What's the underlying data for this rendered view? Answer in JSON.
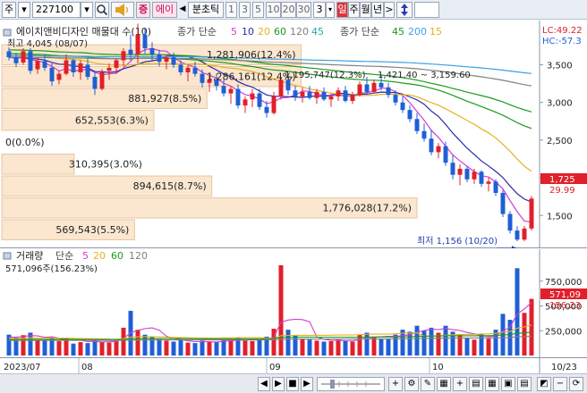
{
  "toolbar": {
    "type_label": "주",
    "code": "227100",
    "search_icon": "magnifier-icon",
    "sound_icon": "speaker-icon",
    "badge": "증",
    "stock_name": "에이",
    "nav_left": "◀",
    "interval_label": "분초틱",
    "intervals": [
      "1",
      "3",
      "5",
      "10",
      "20",
      "30"
    ],
    "period_value": "3",
    "day_label": "일",
    "week_label": "주",
    "month_label": "월",
    "year_label": "년",
    "nav_right": ">",
    "updown_icon": "up-down-arrows-icon"
  },
  "price_legend": {
    "title": "에이치앤비디자인 매물대 수(10)",
    "ma_label": "종가 단순",
    "ma_periods": [
      "5",
      "10",
      "20",
      "60",
      "120",
      "45"
    ],
    "ma_colors": [
      "#d23cd2",
      "#2a2aa6",
      "#e6b21c",
      "#1c9a1c",
      "#808080",
      "#26a6a6"
    ],
    "ma2_label": "종가 단순",
    "ma2_periods": [
      "45",
      "200",
      "15"
    ],
    "ma2_colors": [
      "#1c9a1c",
      "#3ca0e6",
      "#e6b21c"
    ]
  },
  "price_axis": {
    "ticks": [
      "3,500",
      "3,000",
      "2,500",
      "2,000",
      "1,500"
    ],
    "lc": "LC:49.22",
    "hc": "HC:-57.3",
    "current_price": "1,725",
    "current_pct": "29.99"
  },
  "annotations": {
    "high": "최고 4,045 (08/07)",
    "low": "최저 1,156 (10/20)",
    "line1": "1,195,747(12.3%)",
    "line2": "1,421.40 ~ 3,159.60"
  },
  "volume_profile": [
    {
      "label": "1,281,906(12.4%)"
    },
    {
      "label": "1,286,161(12.4%)"
    },
    {
      "label": "881,927(8.5%)"
    },
    {
      "label": "652,553(6.3%)"
    },
    {
      "label": "0(0.0%)"
    },
    {
      "label": "310,395(3.0%)"
    },
    {
      "label": "894,615(8.7%)"
    },
    {
      "label": "1,776,028(17.2%)"
    },
    {
      "label": "569,543(5.5%)"
    }
  ],
  "volume_legend": {
    "title": "거래량",
    "ma_label": "단순",
    "periods": [
      "5",
      "20",
      "60",
      "120"
    ],
    "colors": [
      "#d23cd2",
      "#e6b21c",
      "#1c9a1c",
      "#808080"
    ],
    "current_value": "571,096주(156.23%)"
  },
  "volume_axis": {
    "ticks": [
      "750,000",
      "500,000",
      "250,000"
    ],
    "current_volume": "571,09",
    "current_ratio": "156.23"
  },
  "date_axis": {
    "labels": [
      "2023/07",
      "08",
      "09",
      "10",
      "10/23"
    ]
  },
  "chart_data": {
    "type": "candlestick",
    "title": "에이치앤비디자인",
    "ylim": [
      1100,
      3850
    ],
    "volume_ylim": [
      0,
      1000000
    ],
    "up_color": "#e0202a",
    "down_color": "#1f5fd6",
    "candles": [
      {
        "o": 3680,
        "h": 3730,
        "l": 3560,
        "c": 3600,
        "v": 210000
      },
      {
        "o": 3600,
        "h": 3660,
        "l": 3470,
        "c": 3520,
        "v": 180000
      },
      {
        "o": 3530,
        "h": 3720,
        "l": 3500,
        "c": 3680,
        "v": 205000
      },
      {
        "o": 3680,
        "h": 3720,
        "l": 3380,
        "c": 3420,
        "v": 230000
      },
      {
        "o": 3440,
        "h": 3600,
        "l": 3380,
        "c": 3550,
        "v": 160000
      },
      {
        "o": 3550,
        "h": 3640,
        "l": 3420,
        "c": 3460,
        "v": 150000
      },
      {
        "o": 3460,
        "h": 3520,
        "l": 3220,
        "c": 3280,
        "v": 190000
      },
      {
        "o": 3300,
        "h": 3420,
        "l": 3240,
        "c": 3380,
        "v": 145000
      },
      {
        "o": 3380,
        "h": 3640,
        "l": 3360,
        "c": 3560,
        "v": 175000
      },
      {
        "o": 3560,
        "h": 3580,
        "l": 3340,
        "c": 3400,
        "v": 120000
      },
      {
        "o": 3400,
        "h": 3560,
        "l": 3300,
        "c": 3520,
        "v": 135000
      },
      {
        "o": 3500,
        "h": 3580,
        "l": 3300,
        "c": 3340,
        "v": 125000
      },
      {
        "o": 3340,
        "h": 3420,
        "l": 3100,
        "c": 3180,
        "v": 160000
      },
      {
        "o": 3180,
        "h": 3440,
        "l": 3160,
        "c": 3400,
        "v": 140000
      },
      {
        "o": 3420,
        "h": 3520,
        "l": 3300,
        "c": 3460,
        "v": 130000
      },
      {
        "o": 3460,
        "h": 3580,
        "l": 3380,
        "c": 3560,
        "v": 150000
      },
      {
        "o": 3560,
        "h": 3720,
        "l": 3480,
        "c": 3680,
        "v": 280000
      },
      {
        "o": 3700,
        "h": 3900,
        "l": 3560,
        "c": 3640,
        "v": 450000
      },
      {
        "o": 3640,
        "h": 4045,
        "l": 3520,
        "c": 3900,
        "v": 260000
      },
      {
        "o": 3900,
        "h": 3980,
        "l": 3650,
        "c": 3720,
        "v": 210000
      },
      {
        "o": 3720,
        "h": 3800,
        "l": 3560,
        "c": 3640,
        "v": 190000
      },
      {
        "o": 3640,
        "h": 3700,
        "l": 3480,
        "c": 3540,
        "v": 165000
      },
      {
        "o": 3540,
        "h": 3640,
        "l": 3440,
        "c": 3600,
        "v": 150000
      },
      {
        "o": 3600,
        "h": 3660,
        "l": 3460,
        "c": 3500,
        "v": 140000
      },
      {
        "o": 3500,
        "h": 3560,
        "l": 3360,
        "c": 3400,
        "v": 155000
      },
      {
        "o": 3400,
        "h": 3500,
        "l": 3280,
        "c": 3460,
        "v": 130000
      },
      {
        "o": 3460,
        "h": 3540,
        "l": 3340,
        "c": 3380,
        "v": 125000
      },
      {
        "o": 3380,
        "h": 3440,
        "l": 3200,
        "c": 3260,
        "v": 150000
      },
      {
        "o": 3260,
        "h": 3360,
        "l": 3140,
        "c": 3300,
        "v": 135000
      },
      {
        "o": 3300,
        "h": 3380,
        "l": 3160,
        "c": 3220,
        "v": 140000
      },
      {
        "o": 3220,
        "h": 3300,
        "l": 3080,
        "c": 3120,
        "v": 160000
      },
      {
        "o": 3120,
        "h": 3220,
        "l": 2980,
        "c": 3180,
        "v": 155000
      },
      {
        "o": 3180,
        "h": 3240,
        "l": 2920,
        "c": 2960,
        "v": 175000
      },
      {
        "o": 2960,
        "h": 3080,
        "l": 2860,
        "c": 3040,
        "v": 150000
      },
      {
        "o": 3040,
        "h": 3180,
        "l": 2940,
        "c": 3120,
        "v": 145000
      },
      {
        "o": 3120,
        "h": 3180,
        "l": 2900,
        "c": 2940,
        "v": 160000
      },
      {
        "o": 2940,
        "h": 3020,
        "l": 2800,
        "c": 2860,
        "v": 190000
      },
      {
        "o": 2860,
        "h": 3140,
        "l": 2840,
        "c": 3080,
        "v": 270000
      },
      {
        "o": 3080,
        "h": 3340,
        "l": 3040,
        "c": 3300,
        "v": 910000
      },
      {
        "o": 3300,
        "h": 3380,
        "l": 3100,
        "c": 3160,
        "v": 260000
      },
      {
        "o": 3160,
        "h": 3220,
        "l": 3020,
        "c": 3080,
        "v": 200000
      },
      {
        "o": 3080,
        "h": 3200,
        "l": 3000,
        "c": 3140,
        "v": 170000
      },
      {
        "o": 3140,
        "h": 3220,
        "l": 3040,
        "c": 3060,
        "v": 160000
      },
      {
        "o": 3060,
        "h": 3180,
        "l": 2980,
        "c": 3140,
        "v": 150000
      },
      {
        "o": 3140,
        "h": 3200,
        "l": 3020,
        "c": 3040,
        "v": 140000
      },
      {
        "o": 3040,
        "h": 3120,
        "l": 2940,
        "c": 3080,
        "v": 145000
      },
      {
        "o": 3080,
        "h": 3200,
        "l": 3020,
        "c": 3160,
        "v": 160000
      },
      {
        "o": 3160,
        "h": 3220,
        "l": 3000,
        "c": 3020,
        "v": 150000
      },
      {
        "o": 3020,
        "h": 3140,
        "l": 2980,
        "c": 3100,
        "v": 140000
      },
      {
        "o": 3100,
        "h": 3280,
        "l": 3080,
        "c": 3240,
        "v": 210000
      },
      {
        "o": 3240,
        "h": 3340,
        "l": 3100,
        "c": 3140,
        "v": 230000
      },
      {
        "o": 3140,
        "h": 3300,
        "l": 3120,
        "c": 3260,
        "v": 190000
      },
      {
        "o": 3260,
        "h": 3360,
        "l": 3160,
        "c": 3200,
        "v": 170000
      },
      {
        "o": 3200,
        "h": 3260,
        "l": 3060,
        "c": 3100,
        "v": 165000
      },
      {
        "o": 3100,
        "h": 3160,
        "l": 2960,
        "c": 3000,
        "v": 210000
      },
      {
        "o": 3000,
        "h": 3080,
        "l": 2860,
        "c": 2900,
        "v": 260000
      },
      {
        "o": 2900,
        "h": 2960,
        "l": 2740,
        "c": 2780,
        "v": 240000
      },
      {
        "o": 2780,
        "h": 2860,
        "l": 2580,
        "c": 2620,
        "v": 300000
      },
      {
        "o": 2620,
        "h": 2720,
        "l": 2480,
        "c": 2520,
        "v": 250000
      },
      {
        "o": 2520,
        "h": 2640,
        "l": 2300,
        "c": 2340,
        "v": 280000
      },
      {
        "o": 2340,
        "h": 2460,
        "l": 2260,
        "c": 2420,
        "v": 230000
      },
      {
        "o": 2420,
        "h": 2480,
        "l": 2160,
        "c": 2200,
        "v": 300000
      },
      {
        "o": 2200,
        "h": 2300,
        "l": 1980,
        "c": 2040,
        "v": 240000
      },
      {
        "o": 2040,
        "h": 2180,
        "l": 1900,
        "c": 2120,
        "v": 210000
      },
      {
        "o": 2120,
        "h": 2160,
        "l": 1940,
        "c": 1980,
        "v": 180000
      },
      {
        "o": 1980,
        "h": 2120,
        "l": 1920,
        "c": 2080,
        "v": 160000
      },
      {
        "o": 2080,
        "h": 2100,
        "l": 1880,
        "c": 1920,
        "v": 220000
      },
      {
        "o": 1920,
        "h": 2000,
        "l": 1820,
        "c": 1950,
        "v": 170000
      },
      {
        "o": 1950,
        "h": 1980,
        "l": 1760,
        "c": 1800,
        "v": 260000
      },
      {
        "o": 1800,
        "h": 1840,
        "l": 1480,
        "c": 1520,
        "v": 420000
      },
      {
        "o": 1520,
        "h": 1560,
        "l": 1260,
        "c": 1300,
        "v": 360000
      },
      {
        "o": 1300,
        "h": 1360,
        "l": 1156,
        "c": 1180,
        "v": 880000
      },
      {
        "o": 1180,
        "h": 1360,
        "l": 1160,
        "c": 1327,
        "v": 430000
      },
      {
        "o": 1327,
        "h": 1760,
        "l": 1300,
        "c": 1725,
        "v": 571096
      }
    ]
  }
}
